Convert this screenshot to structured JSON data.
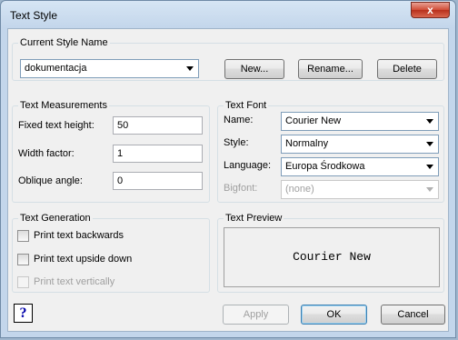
{
  "window": {
    "title": "Text Style",
    "close_label": "x"
  },
  "current_style": {
    "group_label": "Current Style Name",
    "selected": "dokumentacja",
    "new_label": "New...",
    "rename_label": "Rename...",
    "delete_label": "Delete"
  },
  "measurements": {
    "group_label": "Text Measurements",
    "height_label": "Fixed text height:",
    "height_value": "50",
    "width_label": "Width factor:",
    "width_value": "1",
    "oblique_label": "Oblique angle:",
    "oblique_value": "0"
  },
  "font": {
    "group_label": "Text Font",
    "name_label": "Name:",
    "name_value": "Courier New",
    "style_label": "Style:",
    "style_value": "Normalny",
    "language_label": "Language:",
    "language_value": "Europa Środkowa",
    "bigfont_label": "Bigfont:",
    "bigfont_value": "(none)"
  },
  "generation": {
    "group_label": "Text Generation",
    "backwards_label": "Print text backwards",
    "upside_label": "Print text upside down",
    "vertical_label": "Print text vertically"
  },
  "preview": {
    "group_label": "Text Preview",
    "text": "Courier New"
  },
  "footer": {
    "help_label": "?",
    "apply_label": "Apply",
    "ok_label": "OK",
    "cancel_label": "Cancel"
  }
}
